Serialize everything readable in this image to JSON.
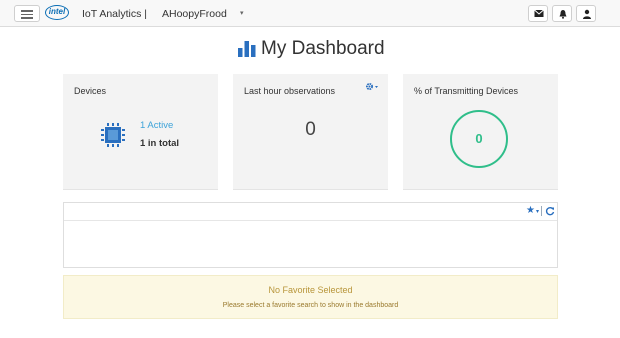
{
  "header": {
    "app_title": "IoT Analytics |",
    "logo_text": "intel",
    "account_name": "AHoopyFrood",
    "caret": "▾"
  },
  "page": {
    "title": "My Dashboard"
  },
  "devices_card": {
    "title": "Devices",
    "active_text": "1 Active",
    "total_text": "1 in total"
  },
  "observations_card": {
    "title": "Last hour observations",
    "value": "0"
  },
  "transmitting_card": {
    "title": "% of Transmitting Devices",
    "value": "0"
  },
  "favorites": {
    "star": "★",
    "caret": "▾",
    "notice_title": "No Favorite Selected",
    "notice_body": "Please select a favorite search to show in the dashboard"
  },
  "colors": {
    "accent_blue": "#2a6fbf",
    "link_blue": "#3da3d9",
    "success_green": "#2fbe8a",
    "warning_bg": "#fcf8e3",
    "warning_text": "#b8963b"
  },
  "icons": [
    "menu-icon",
    "intel-logo",
    "mail-icon",
    "bell-icon",
    "user-icon",
    "bar-chart-icon",
    "chip-icon",
    "gear-icon",
    "star-icon",
    "refresh-icon"
  ]
}
